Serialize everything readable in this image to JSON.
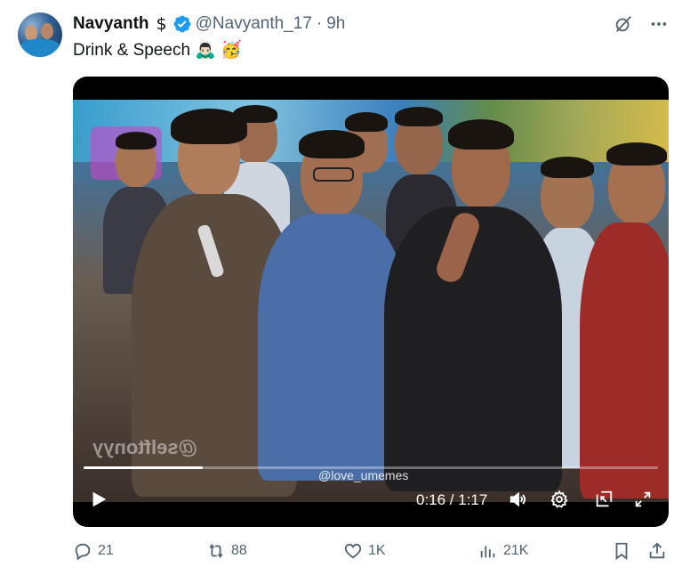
{
  "author": {
    "name": "Navyanth",
    "dollar_symbol": "$",
    "handle": "@Navyanth_17",
    "separator": "·",
    "time": "9h",
    "verified_color": "#1d9bf0"
  },
  "tweet": {
    "text": "Drink & Speech 🙇🏻‍♂️ 🥳"
  },
  "video": {
    "watermark": "@love_umemes",
    "watermark_reversed": "@selftonyy",
    "time_readout": "0:16 / 1:17",
    "progress_fraction": 0.207
  },
  "actions": {
    "replies": "21",
    "reposts": "88",
    "likes": "1K",
    "views": "21K"
  },
  "colors": {
    "text_primary": "#0f1419",
    "text_secondary": "#536471",
    "accent": "#1d9bf0"
  },
  "icons": {
    "more": "more-dots-icon",
    "grok": "grok-icon",
    "reply": "reply-icon",
    "repost": "repost-icon",
    "like": "like-icon",
    "views": "views-icon",
    "bookmark": "bookmark-icon",
    "share": "share-icon"
  }
}
